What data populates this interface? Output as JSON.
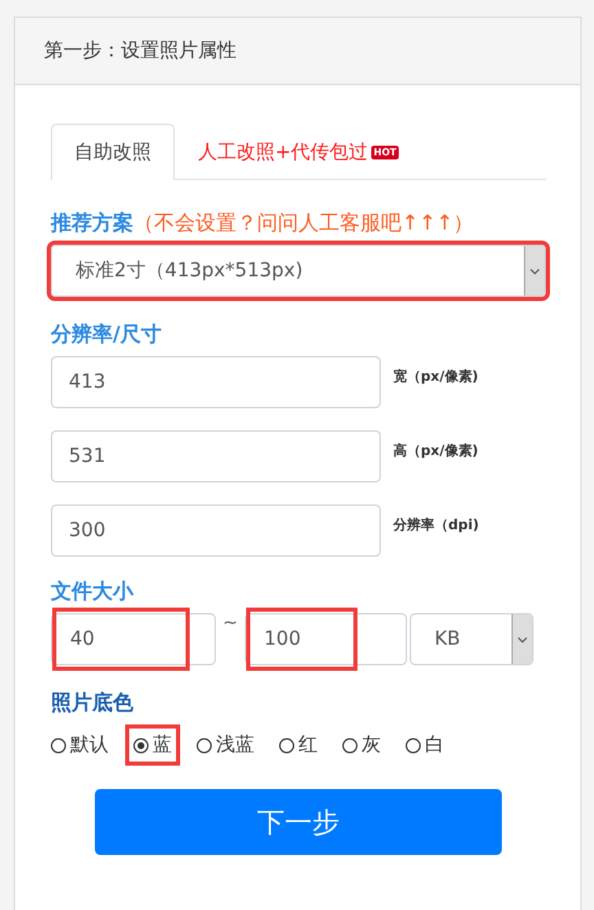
{
  "panel": {
    "title": "第一步：设置照片属性"
  },
  "tabs": [
    {
      "label": "自助改照",
      "selected": true,
      "hot": false
    },
    {
      "label": "人工改照+代传包过",
      "selected": false,
      "hot": true,
      "badge": "HOT"
    }
  ],
  "preset": {
    "label": "推荐方案",
    "hint": "（不会设置？问问人工客服吧↑↑↑）",
    "value": "标准2寸（413px*513px)",
    "highlighted": true
  },
  "resolution": {
    "label": "分辨率/尺寸",
    "fields": [
      {
        "value": "413",
        "unit": "宽（px/像素)"
      },
      {
        "value": "531",
        "unit": "高（px/像素)"
      },
      {
        "value": "300",
        "unit": "分辨率（dpi)"
      }
    ]
  },
  "file_size": {
    "label": "文件大小",
    "min": {
      "value": "40",
      "highlighted": true
    },
    "separator": "~",
    "max": {
      "value": "100",
      "highlighted": true
    },
    "unit": "KB"
  },
  "background": {
    "label": "照片底色",
    "options": [
      {
        "label": "默认",
        "selected": false,
        "highlighted": false
      },
      {
        "label": "蓝",
        "selected": true,
        "highlighted": true
      },
      {
        "label": "浅蓝",
        "selected": false,
        "highlighted": false
      },
      {
        "label": "红",
        "selected": false,
        "highlighted": false
      },
      {
        "label": "灰",
        "selected": false,
        "highlighted": false
      },
      {
        "label": "白",
        "selected": false,
        "highlighted": false
      }
    ]
  },
  "next_button": "下一步"
}
